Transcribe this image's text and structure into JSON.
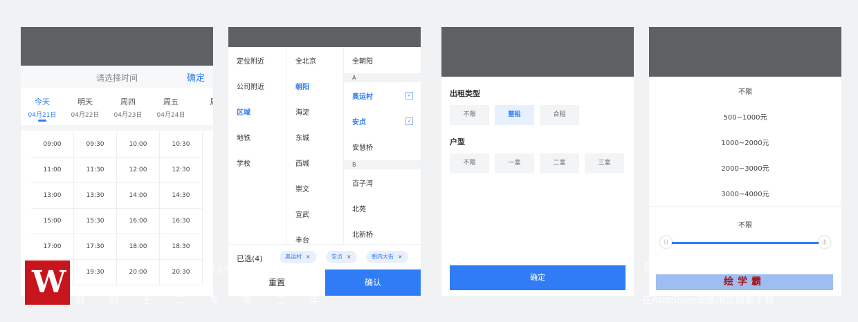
{
  "time_panel": {
    "title": "请选择时间",
    "confirm": "确定",
    "days": [
      {
        "week": "今天",
        "date": "04月21日",
        "active": true
      },
      {
        "week": "明天",
        "date": "04月22日"
      },
      {
        "week": "周四",
        "date": "04月23日"
      },
      {
        "week": "周五",
        "date": "04月24日"
      },
      {
        "week": "周",
        "date": ""
      }
    ],
    "slots": [
      [
        "09:00",
        "09:30",
        "10:00",
        "10:30"
      ],
      [
        "11:00",
        "11:30",
        "12:00",
        "12:30"
      ],
      [
        "13:00",
        "13:30",
        "14:00",
        "14:30"
      ],
      [
        "15:00",
        "15:30",
        "16:00",
        "16:30"
      ],
      [
        "17:00",
        "17:30",
        "18:00",
        "18:30"
      ],
      [
        "",
        "19:30",
        "20:00",
        "20:30"
      ]
    ]
  },
  "location_panel": {
    "categories": [
      "定位附近",
      "公司附近",
      "区域",
      "地铁",
      "学校"
    ],
    "active_category": "区域",
    "districts": [
      "全北京",
      "朝阳",
      "海淀",
      "东城",
      "西城",
      "崇文",
      "宣武",
      "丰台"
    ],
    "active_district": "朝阳",
    "areas_all": "全朝阳",
    "group_a": "A",
    "areas_a": [
      {
        "name": "奥运村",
        "checked": true
      },
      {
        "name": "安贞",
        "checked": true
      },
      {
        "name": "安慧桥",
        "checked": false
      }
    ],
    "group_b": "B",
    "areas_b": [
      "百子湾",
      "北苑",
      "北新桥"
    ],
    "selected_label": "已选(4)",
    "selected_tags": [
      "奥运村",
      "安贞",
      "朝内大街"
    ],
    "reset": "重置",
    "confirm": "确认"
  },
  "rent_panel": {
    "rent_type_title": "出租类型",
    "rent_types": [
      "不限",
      "整租",
      "合租"
    ],
    "rent_type_selected": "整租",
    "room_title": "户型",
    "room_types": [
      "不限",
      "一室",
      "二室",
      "三室"
    ],
    "confirm": "确定"
  },
  "price_panel": {
    "prices": [
      "不限",
      "500~1000元",
      "1000~2000元",
      "2000~3000元",
      "3000~4000元"
    ],
    "range_label": "不限"
  },
  "watermark": {
    "left_bottom": "陷 创 于 二 零 零 二 年",
    "left_top": "以人为",
    "right_top": "获得更多免费精品教程",
    "brand": "绘学霸",
    "right_bottom": "在AppStore或應用宝搜索下载"
  },
  "colors": {
    "accent": "#2f7cf6",
    "header_gray": "#5f6063",
    "logo_red": "#c8141c"
  }
}
